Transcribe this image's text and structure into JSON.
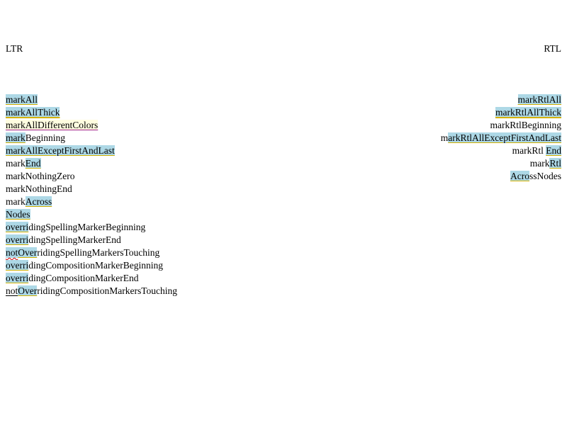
{
  "ltr": {
    "heading": "LTR",
    "lines": [
      [
        {
          "t": "markAll",
          "c": "hl ul-gold"
        }
      ],
      [
        {
          "t": "markAllThick",
          "c": "hl ul-gold-thick"
        }
      ],
      [
        {
          "t": "markAllDifferentColors",
          "c": "hl-pale ul-purple"
        }
      ],
      [
        {
          "t": "mark",
          "c": "hl ul-gold"
        },
        {
          "t": "Beginning",
          "c": ""
        }
      ],
      [
        {
          "t": "markAllExceptFirstAndLast",
          "c": "hl ul-gold"
        }
      ],
      [
        {
          "t": "mark",
          "c": ""
        },
        {
          "t": "End",
          "c": "hl ul-gold"
        }
      ],
      [
        {
          "t": "markNothingZero",
          "c": ""
        }
      ],
      [
        {
          "t": "markNothingEnd",
          "c": ""
        }
      ],
      [
        {
          "t": "mark",
          "c": ""
        },
        {
          "t": "Across",
          "c": "hl ul-gold"
        }
      ],
      [
        {
          "t": "Nodes",
          "c": "hl ul-gold"
        }
      ],
      [
        {
          "t": "overri",
          "c": "hl ul-gold"
        },
        {
          "t": "dingSpellingMarkerBeginning",
          "c": ""
        }
      ],
      [
        {
          "t": "overri",
          "c": "hl ul-gold"
        },
        {
          "t": "dingSpellingMarkerEnd",
          "c": ""
        }
      ],
      [
        {
          "t": "not",
          "c": "hl ul-red"
        },
        {
          "t": "Over",
          "c": "hl ul-gold"
        },
        {
          "t": "ridingSpellingMarkersTouching",
          "c": ""
        }
      ],
      [
        {
          "t": "overri",
          "c": "hl ul-gold"
        },
        {
          "t": "dingCompositionMarkerBeginning",
          "c": ""
        }
      ],
      [
        {
          "t": "overri",
          "c": "hl ul-gold"
        },
        {
          "t": "dingCompositionMarkerEnd",
          "c": ""
        }
      ],
      [
        {
          "t": "not",
          "c": "ul-black"
        },
        {
          "t": "Over",
          "c": "hl ul-gold"
        },
        {
          "t": "ridingCompositionMarkersTouching",
          "c": ""
        }
      ]
    ]
  },
  "rtl": {
    "heading": "RTL",
    "lines": [
      [
        {
          "t": "markRtlAll",
          "c": "hl ul-gold"
        }
      ],
      [
        {
          "t": "markRtlAllThick",
          "c": "hl ul-gold-thick"
        }
      ],
      [
        {
          "t": "markRtlBeginning",
          "c": ""
        }
      ],
      [
        {
          "t": "m",
          "c": ""
        },
        {
          "t": "arkRtlAllExceptFirstAndLast",
          "c": "hl ul-gold"
        }
      ],
      [
        {
          "t": "markRtl ",
          "c": ""
        },
        {
          "t": "End",
          "c": "hl ul-gold"
        }
      ],
      [
        {
          "t": "mark",
          "c": ""
        },
        {
          "t": "Rtl",
          "c": "hl ul-gold"
        }
      ],
      [
        {
          "t": "Acro",
          "c": "hl ul-gold"
        },
        {
          "t": "ssNodes",
          "c": ""
        }
      ]
    ]
  },
  "colors": {
    "highlight": "#add8e6",
    "highlight_pale": "#fffde0",
    "underline_gold": "#d4b100",
    "underline_purple": "#a0208a",
    "underline_red": "#d00000"
  }
}
